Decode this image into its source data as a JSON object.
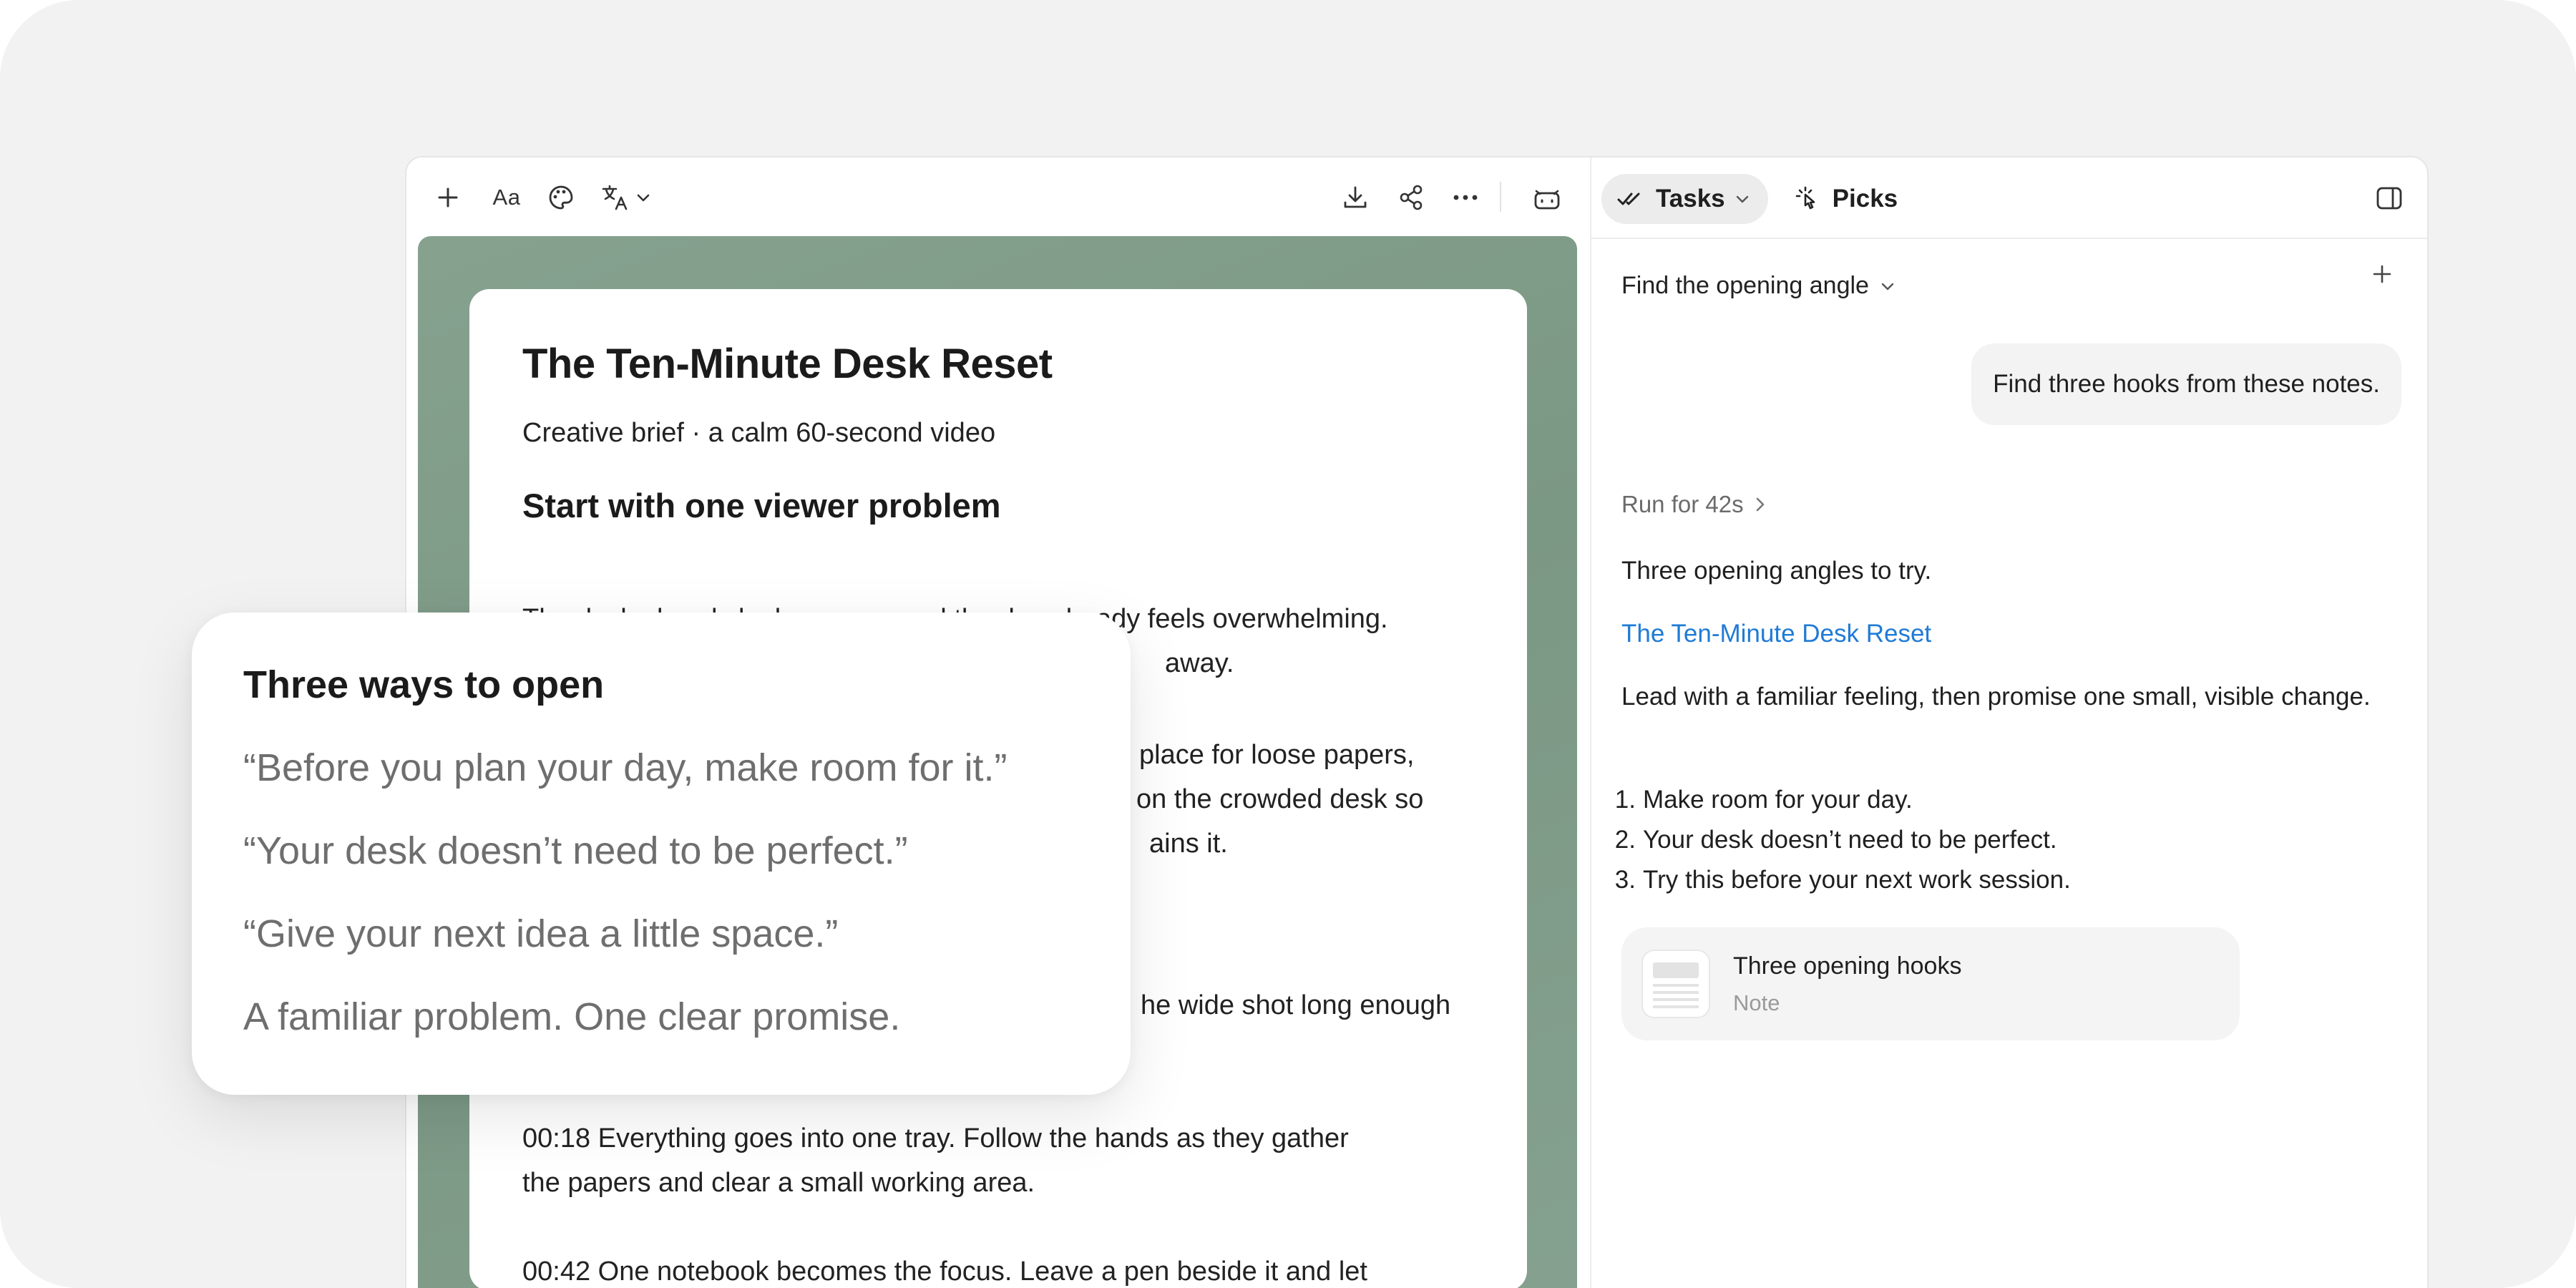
{
  "toolbar": {
    "font_label": "Aa"
  },
  "panel": {
    "tabs": [
      {
        "label": "Tasks"
      },
      {
        "label": "Picks"
      }
    ],
    "thread_title": "Find the opening angle",
    "user_message": "Find three hooks from these notes.",
    "run_label": "Run for 42s",
    "response_intro": "Three opening angles to try.",
    "response_link": "The Ten-Minute Desk Reset",
    "response_body": "Lead with a familiar feeling, then promise one small, visible change.",
    "response_list": [
      {
        "num": "1.",
        "text": "Make room for your day."
      },
      {
        "num": "2.",
        "text": "Your desk doesn’t need to be perfect."
      },
      {
        "num": "3.",
        "text": "Try this before your next work session."
      }
    ],
    "attachment": {
      "title": "Three opening hooks",
      "type": "Note"
    }
  },
  "document": {
    "title": "The Ten-Minute Desk Reset",
    "subtitle": "Creative brief · a calm 60-second video",
    "heading": "Start with one viewer problem",
    "paragraph_1_line_1": "The desk already looks messy, and the day already feels overwhelming.",
    "paragraph_1_line_2": "away.",
    "paragraph_2_line_1": "place for loose papers,",
    "paragraph_2_line_2": "on the crowded desk so",
    "paragraph_2_line_3": "ains it.",
    "paragraph_3_line_1": "he wide shot long enough",
    "beat_1_line_1": "00:18  Everything goes into one tray. Follow the hands as they gather",
    "beat_1_line_2": "the papers and clear a small working area.",
    "beat_2_line_1": "00:42  One notebook becomes the focus. Leave a pen beside it and let"
  },
  "overlay": {
    "title": "Three ways to open",
    "lines": [
      "“Before you plan your day, make room for it.”",
      "“Your desk doesn’t need to be perfect.”",
      "“Give your next idea a little space.”",
      "A familiar problem. One clear promise."
    ]
  },
  "icons": {
    "add": "plus-icon",
    "theme": "palette-icon",
    "translate": "translate-icon",
    "download": "download-icon",
    "share": "share-icon",
    "more": "more-icon",
    "assistant": "robot-icon",
    "tasks": "double-check-icon",
    "picks": "pointer-click-icon",
    "panel": "panel-toggle-icon"
  },
  "colors": {
    "canvas_green": "#7f9c88",
    "link_blue": "#1f7bd6",
    "stage_bg": "#f2f2f2"
  }
}
